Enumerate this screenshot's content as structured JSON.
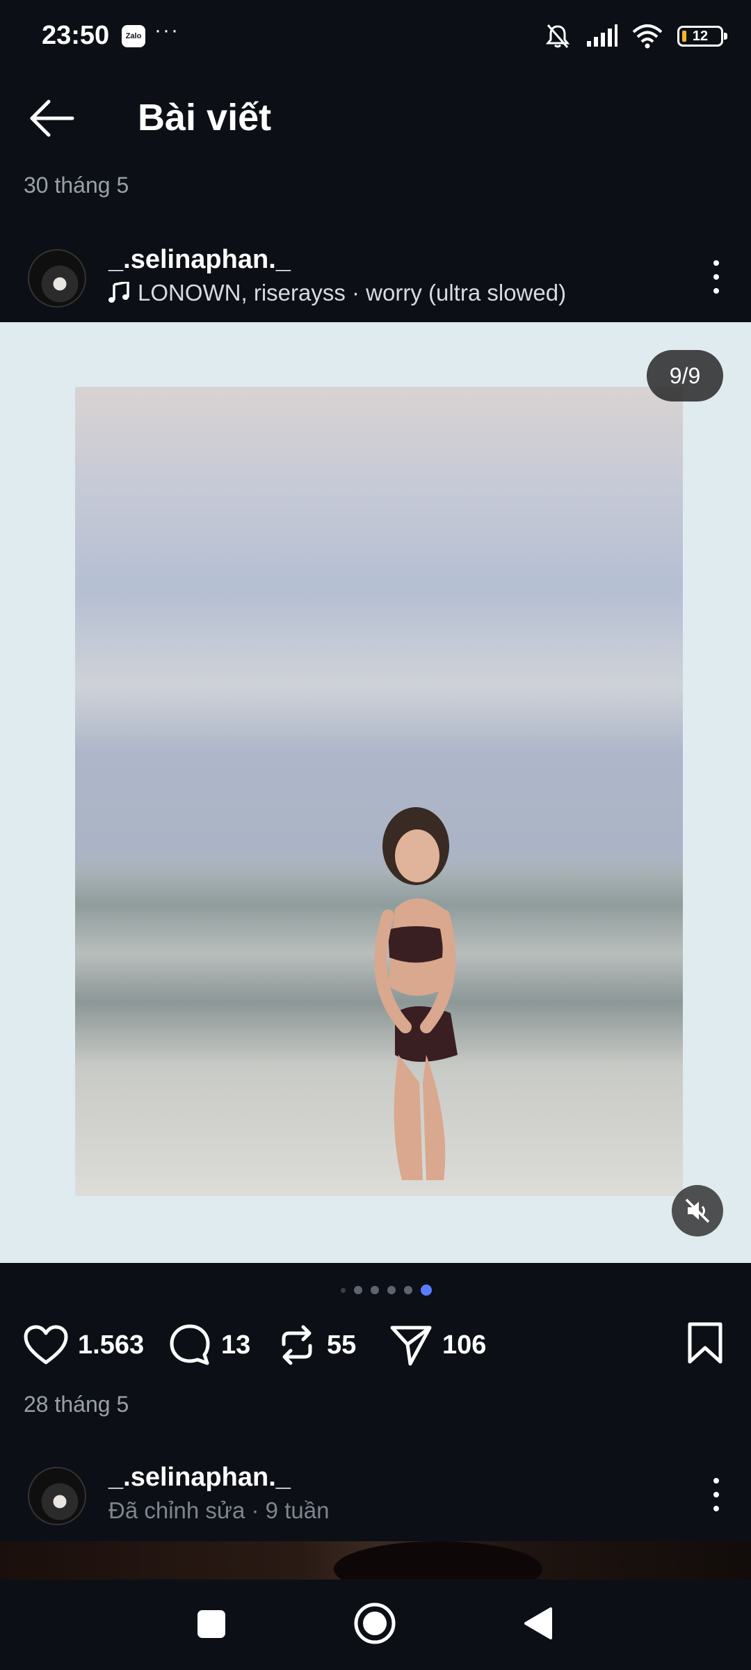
{
  "status_bar": {
    "time": "23:50",
    "app_badge": "Zalo",
    "more": "···",
    "battery": "12",
    "icons": [
      "bell-off-icon",
      "signal-icon",
      "wifi-icon",
      "battery-icon"
    ]
  },
  "header": {
    "title": "Bài viết",
    "back_icon": "arrow-left-icon"
  },
  "post1": {
    "date": "30 tháng 5",
    "author": "_.selinaphan._",
    "music": "LONOWN, riserayss · worry (ultra slowed)",
    "page_counter": "9/9",
    "pager": {
      "count": 6,
      "active": 6
    },
    "likes": "1.563",
    "comments": "13",
    "reposts": "55",
    "shares": "106"
  },
  "post2": {
    "date": "28 tháng 5",
    "author": "_.selinaphan._",
    "meta": "Đã chỉnh sửa · 9 tuần"
  },
  "colors": {
    "background": "#0c1016",
    "media_bg": "#dfebee",
    "pager_active": "#5a7cff",
    "battery_level": "#f0b429"
  }
}
